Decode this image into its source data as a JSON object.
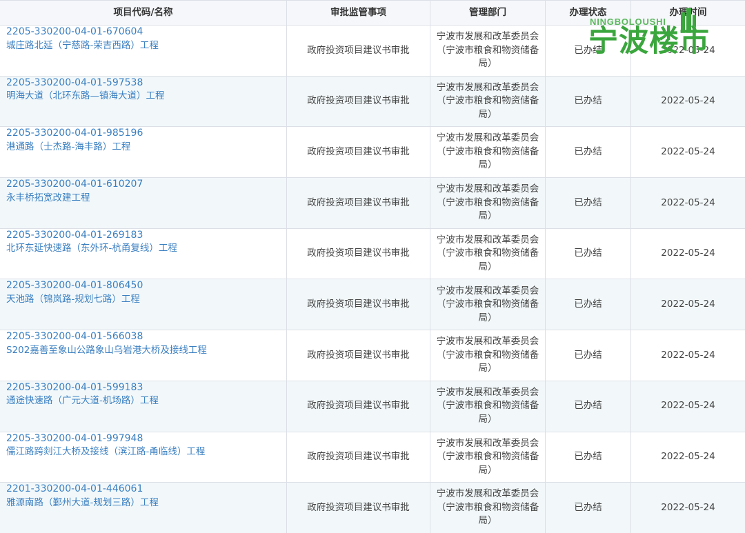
{
  "table": {
    "headers": [
      "项目代码/名称",
      "审批监管事项",
      "管理部门",
      "办理状态",
      "办理时间"
    ],
    "rows": [
      {
        "code": "2205-330200-04-01-670604",
        "name": "城庄路北延（宁慈路-荣吉西路）工程",
        "matter": "政府投资项目建议书审批",
        "dept": "宁波市发展和改革委员会（宁波市粮食和物资储备局）",
        "status": "已办结",
        "date": "2022-05-24"
      },
      {
        "code": "2205-330200-04-01-597538",
        "name": "明海大道（北环东路—镇海大道）工程",
        "matter": "政府投资项目建议书审批",
        "dept": "宁波市发展和改革委员会（宁波市粮食和物资储备局）",
        "status": "已办结",
        "date": "2022-05-24"
      },
      {
        "code": "2205-330200-04-01-985196",
        "name": "港通路（士杰路-海丰路）工程",
        "matter": "政府投资项目建议书审批",
        "dept": "宁波市发展和改革委员会（宁波市粮食和物资储备局）",
        "status": "已办结",
        "date": "2022-05-24"
      },
      {
        "code": "2205-330200-04-01-610207",
        "name": "永丰桥拓宽改建工程",
        "matter": "政府投资项目建议书审批",
        "dept": "宁波市发展和改革委员会（宁波市粮食和物资储备局）",
        "status": "已办结",
        "date": "2022-05-24"
      },
      {
        "code": "2205-330200-04-01-269183",
        "name": "北环东延快速路（东外环-杭甬复线）工程",
        "matter": "政府投资项目建议书审批",
        "dept": "宁波市发展和改革委员会（宁波市粮食和物资储备局）",
        "status": "已办结",
        "date": "2022-05-24"
      },
      {
        "code": "2205-330200-04-01-806450",
        "name": "天池路（锦岚路-规划七路）工程",
        "matter": "政府投资项目建议书审批",
        "dept": "宁波市发展和改革委员会（宁波市粮食和物资储备局）",
        "status": "已办结",
        "date": "2022-05-24"
      },
      {
        "code": "2205-330200-04-01-566038",
        "name": "S202嘉善至象山公路象山乌岩港大桥及接线工程",
        "matter": "政府投资项目建议书审批",
        "dept": "宁波市发展和改革委员会（宁波市粮食和物资储备局）",
        "status": "已办结",
        "date": "2022-05-24"
      },
      {
        "code": "2205-330200-04-01-599183",
        "name": "通途快速路（广元大道-机场路）工程",
        "matter": "政府投资项目建议书审批",
        "dept": "宁波市发展和改革委员会（宁波市粮食和物资储备局）",
        "status": "已办结",
        "date": "2022-05-24"
      },
      {
        "code": "2205-330200-04-01-997948",
        "name": "儒江路跨剡江大桥及接线（滨江路-甬临线）工程",
        "matter": "政府投资项目建议书审批",
        "dept": "宁波市发展和改革委员会（宁波市粮食和物资储备局）",
        "status": "已办结",
        "date": "2022-05-24"
      },
      {
        "code": "2201-330200-04-01-446061",
        "name": "雅源南路（鄞州大道-规划三路）工程",
        "matter": "政府投资项目建议书审批",
        "dept": "宁波市发展和改革委员会（宁波市粮食和物资储备局）",
        "status": "已办结",
        "date": "2022-05-24"
      }
    ]
  },
  "watermark": {
    "latin": "NINGBOLOUSHI",
    "chinese": "宁波楼市"
  },
  "colors": {
    "link": "#3a7fc1",
    "header_bg": "#f5f7fa",
    "stripe_bg": "#f2f8fa",
    "watermark": "#3aa63d"
  }
}
